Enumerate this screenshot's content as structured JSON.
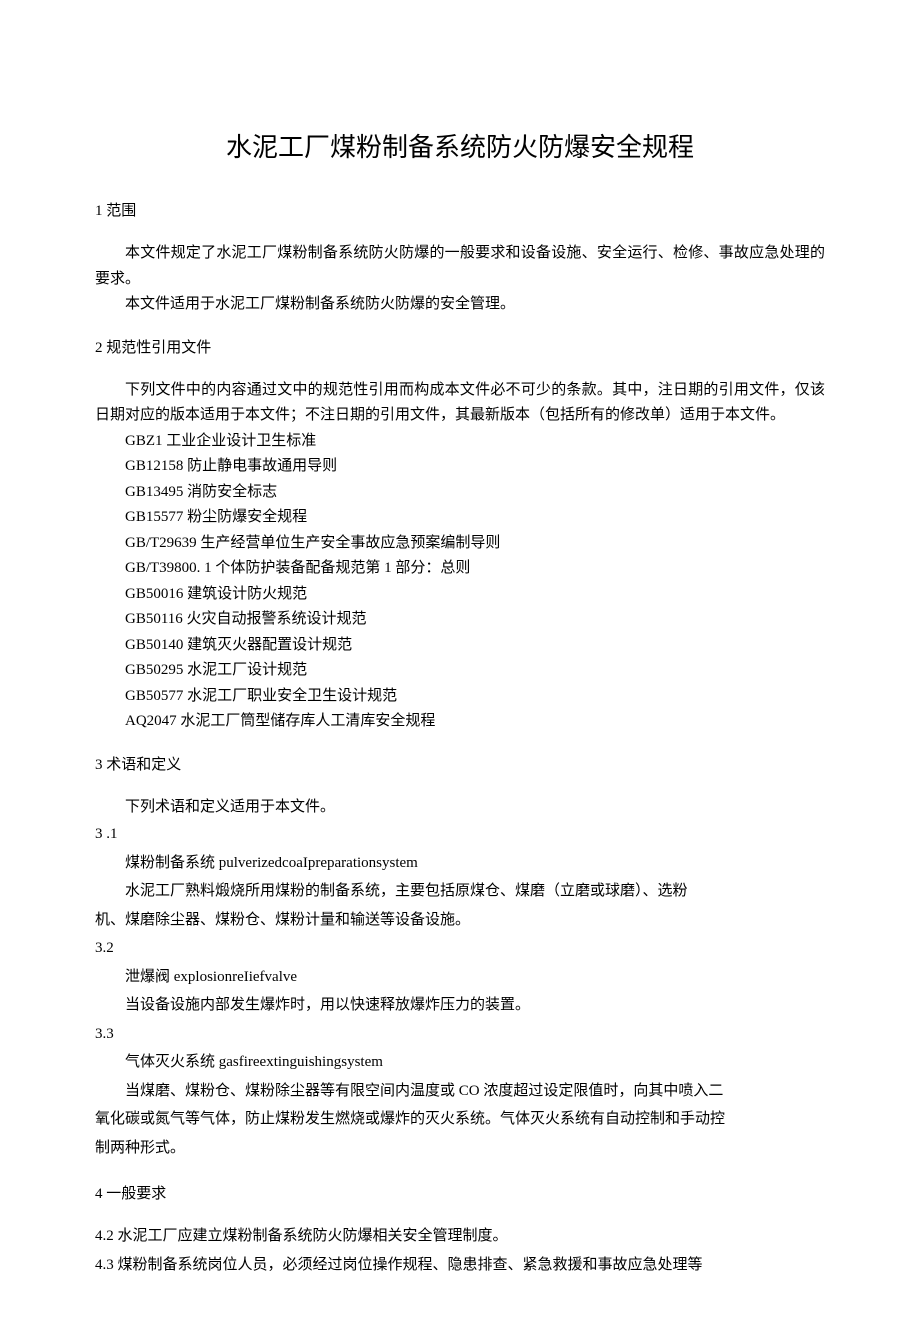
{
  "title": "水泥工厂煤粉制备系统防火防爆安全规程",
  "section1": {
    "heading": "1 范围",
    "para1": "本文件规定了水泥工厂煤粉制备系统防火防爆的一般要求和设备设施、安全运行、检修、事故应急处理的要求。",
    "para2": "本文件适用于水泥工厂煤粉制备系统防火防爆的安全管理。"
  },
  "section2": {
    "heading": "2 规范性引用文件",
    "intro": "下列文件中的内容通过文中的规范性引用而构成本文件必不可少的条款。其中，注日期的引用文件，仅该日期对应的版本适用于本文件；不注日期的引用文件，其最新版本（包括所有的修改单）适用于本文件。",
    "refs": [
      "GBZ1 工业企业设计卫生标准",
      "GB12158 防止静电事故通用导则",
      "GB13495 消防安全标志",
      "GB15577 粉尘防爆安全规程",
      "GB/T29639 生产经营单位生产安全事故应急预案编制导则",
      "GB/T39800. 1 个体防护装备配备规范第 1 部分：总则",
      "GB50016 建筑设计防火规范",
      "GB50116 火灾自动报警系统设计规范",
      "GB50140 建筑灭火器配置设计规范",
      "GB50295 水泥工厂设计规范",
      "GB50577 水泥工厂职业安全卫生设计规范",
      "AQ2047 水泥工厂筒型储存库人工清库安全规程"
    ]
  },
  "section3": {
    "heading": "3 术语和定义",
    "intro": "下列术语和定义适用于本文件。",
    "def1": {
      "num": "3  .1",
      "term": "煤粉制备系统 pulverizedcoaIpreparationsystem",
      "desc1": "水泥工厂熟料煅烧所用煤粉的制备系统，主要包括原煤仓、煤磨（立磨或球磨）、选粉",
      "desc2": "机、煤磨除尘器、煤粉仓、煤粉计量和输送等设备设施。"
    },
    "def2": {
      "num": "3.2",
      "term": "泄爆阀 explosionreIiefvalve",
      "desc": "当设备设施内部发生爆炸时，用以快速释放爆炸压力的装置。"
    },
    "def3": {
      "num": "3.3",
      "term": "气体灭火系统 gasfireextinguishingsystem",
      "desc1": "当煤磨、煤粉仓、煤粉除尘器等有限空间内温度或 CO 浓度超过设定限值时，向其中喷入二",
      "desc2": "氧化碳或氮气等气体，防止煤粉发生燃烧或爆炸的灭火系统。气体灭火系统有自动控制和手动控",
      "desc3": "制两种形式。"
    }
  },
  "section4": {
    "heading": "4  一般要求",
    "item1": "4.2  水泥工厂应建立煤粉制备系统防火防爆相关安全管理制度。",
    "item2": "4.3  煤粉制备系统岗位人员，必须经过岗位操作规程、隐患排查、紧急救援和事故应急处理等"
  }
}
